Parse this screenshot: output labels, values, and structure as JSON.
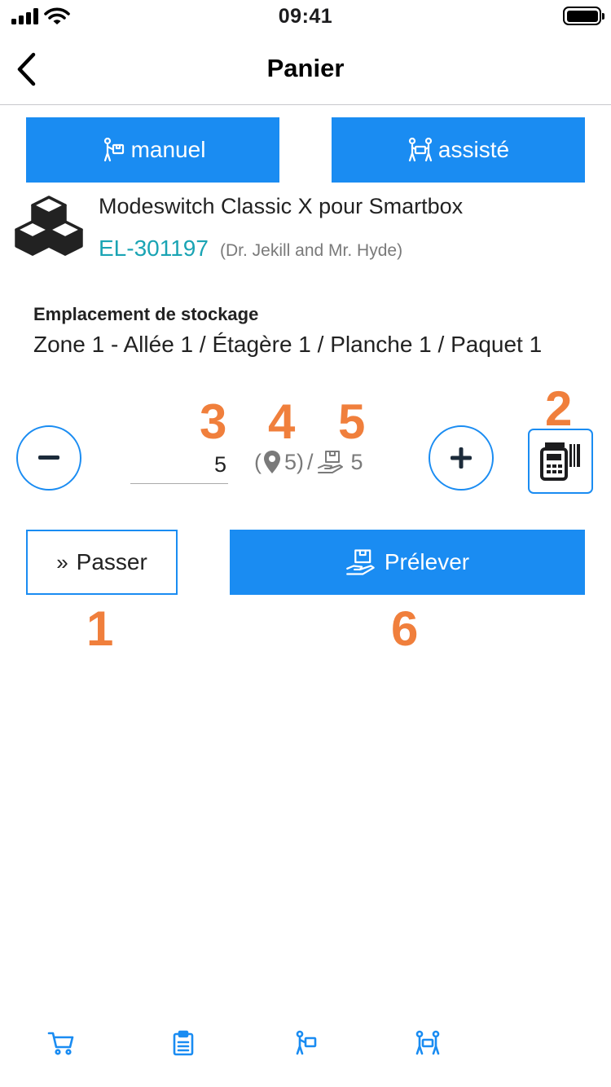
{
  "status_bar": {
    "time": "09:41"
  },
  "nav": {
    "title": "Panier"
  },
  "modes": {
    "manual_label": "manuel",
    "assisted_label": "assisté"
  },
  "product": {
    "title": "Modeswitch Classic X pour Smartbox",
    "reference": "EL-301197",
    "brand": "(Dr. Jekill and Mr. Hyde)"
  },
  "storage": {
    "label": "Emplacement de stockage",
    "value": "Zone 1 - Allée 1 / Étagère 1 / Planche 1 / Paquet 1"
  },
  "quantity": {
    "value": "5",
    "paren_open": "(",
    "location_stock": "5)",
    "separator": "/",
    "picked": "5"
  },
  "actions": {
    "skip_glyph": "»",
    "skip_label": "Passer",
    "pick_label": "Prélever"
  },
  "callouts": [
    "1",
    "2",
    "3",
    "4",
    "5",
    "6"
  ],
  "colors": {
    "primary": "#1a8cf2",
    "link": "#1aa4b4",
    "callout": "#f07f3c"
  },
  "tabs": [
    "cart-icon",
    "clipboard-list-icon",
    "manual-carry-icon",
    "assisted-carry-icon"
  ]
}
